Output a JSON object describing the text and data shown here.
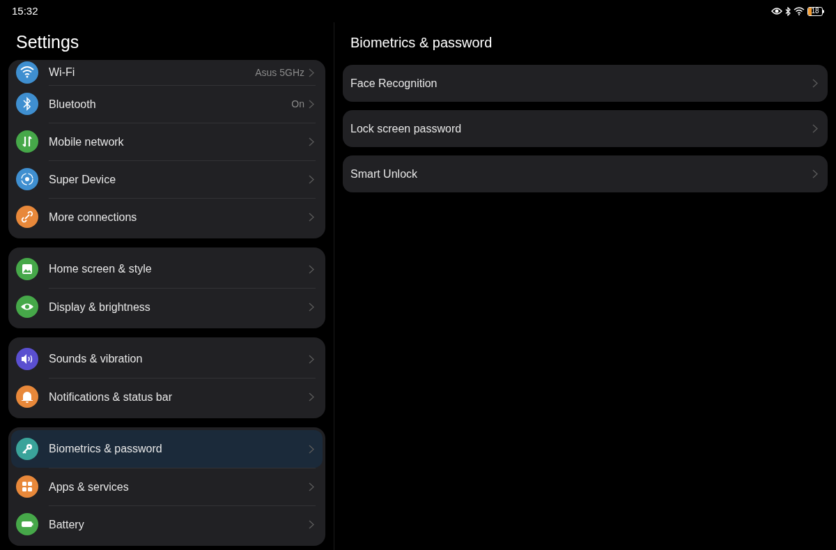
{
  "status_bar": {
    "time": "15:32",
    "battery": "18"
  },
  "sidebar": {
    "title": "Settings",
    "groups": [
      {
        "items": [
          {
            "label": "Wi-Fi",
            "value": "Asus 5GHz",
            "kind": "wifi",
            "color": "#3f8fd0",
            "selected": false
          },
          {
            "label": "Bluetooth",
            "value": "On",
            "kind": "bluetooth",
            "color": "#3f8fd0",
            "selected": false
          },
          {
            "label": "Mobile network",
            "kind": "mobile",
            "color": "#46a849",
            "selected": false
          },
          {
            "label": "Super Device",
            "kind": "device",
            "color": "#3f8fd0",
            "selected": false
          },
          {
            "label": "More connections",
            "kind": "link",
            "color": "#e8883a",
            "selected": false
          }
        ]
      },
      {
        "items": [
          {
            "label": "Home screen & style",
            "kind": "image",
            "color": "#46a849",
            "selected": false
          },
          {
            "label": "Display & brightness",
            "kind": "eye",
            "color": "#46a849",
            "selected": false
          }
        ]
      },
      {
        "items": [
          {
            "label": "Sounds & vibration",
            "kind": "speaker",
            "color": "#5a4fd0",
            "selected": false
          },
          {
            "label": "Notifications & status bar",
            "kind": "bell",
            "color": "#e8883a",
            "selected": false
          }
        ]
      },
      {
        "items": [
          {
            "label": "Biometrics & password",
            "kind": "key",
            "color": "#3aa39a",
            "selected": true
          },
          {
            "label": "Apps & services",
            "kind": "apps",
            "color": "#e8883a",
            "selected": false
          },
          {
            "label": "Battery",
            "kind": "battery",
            "color": "#46a849",
            "selected": false
          }
        ]
      }
    ]
  },
  "detail": {
    "title": "Biometrics & password",
    "items": [
      {
        "label": "Face Recognition"
      },
      {
        "label": "Lock screen password"
      },
      {
        "label": "Smart Unlock"
      }
    ]
  }
}
